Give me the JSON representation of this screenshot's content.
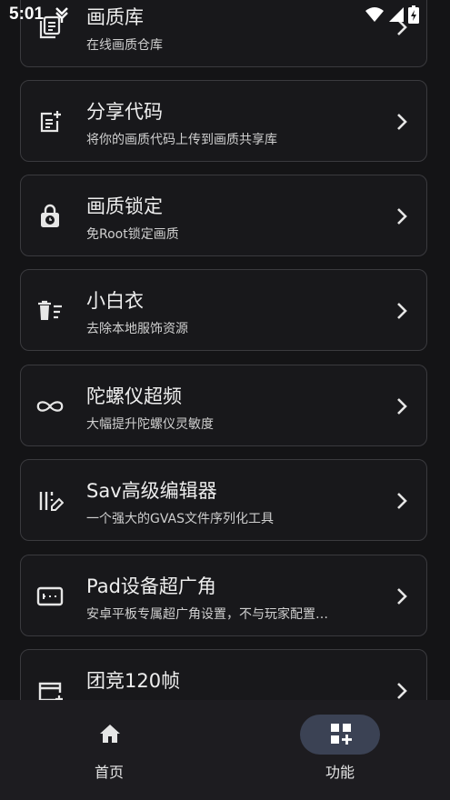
{
  "status": {
    "time": "5:01"
  },
  "cards": [
    {
      "title": "画质库",
      "subtitle": "在线画质仓库",
      "icon": "library-icon"
    },
    {
      "title": "分享代码",
      "subtitle": "将你的画质代码上传到画质共享库",
      "icon": "post-add-icon"
    },
    {
      "title": "画质锁定",
      "subtitle": "免Root锁定画质",
      "icon": "lock-clock-icon"
    },
    {
      "title": "小白衣",
      "subtitle": "去除本地服饰资源",
      "icon": "delete-sweep-icon"
    },
    {
      "title": "陀螺仪超频",
      "subtitle": "大幅提升陀螺仪灵敏度",
      "icon": "infinity-icon"
    },
    {
      "title": "Sav高级编辑器",
      "subtitle": "一个强大的GVAS文件序列化工具",
      "icon": "edit-columns-icon"
    },
    {
      "title": "Pad设备超广角",
      "subtitle": "安卓平板专属超广角设置，不与玩家配置…",
      "icon": "tablet-wide-icon"
    },
    {
      "title": "团竞120帧",
      "subtitle": "",
      "icon": "card-add-icon"
    }
  ],
  "nav": {
    "home_label": "首页",
    "func_label": "功能"
  },
  "colors": {
    "background": "#141416",
    "card": "#18181b",
    "card_border": "#3a3a3e",
    "nav_pill": "#3b4254"
  }
}
